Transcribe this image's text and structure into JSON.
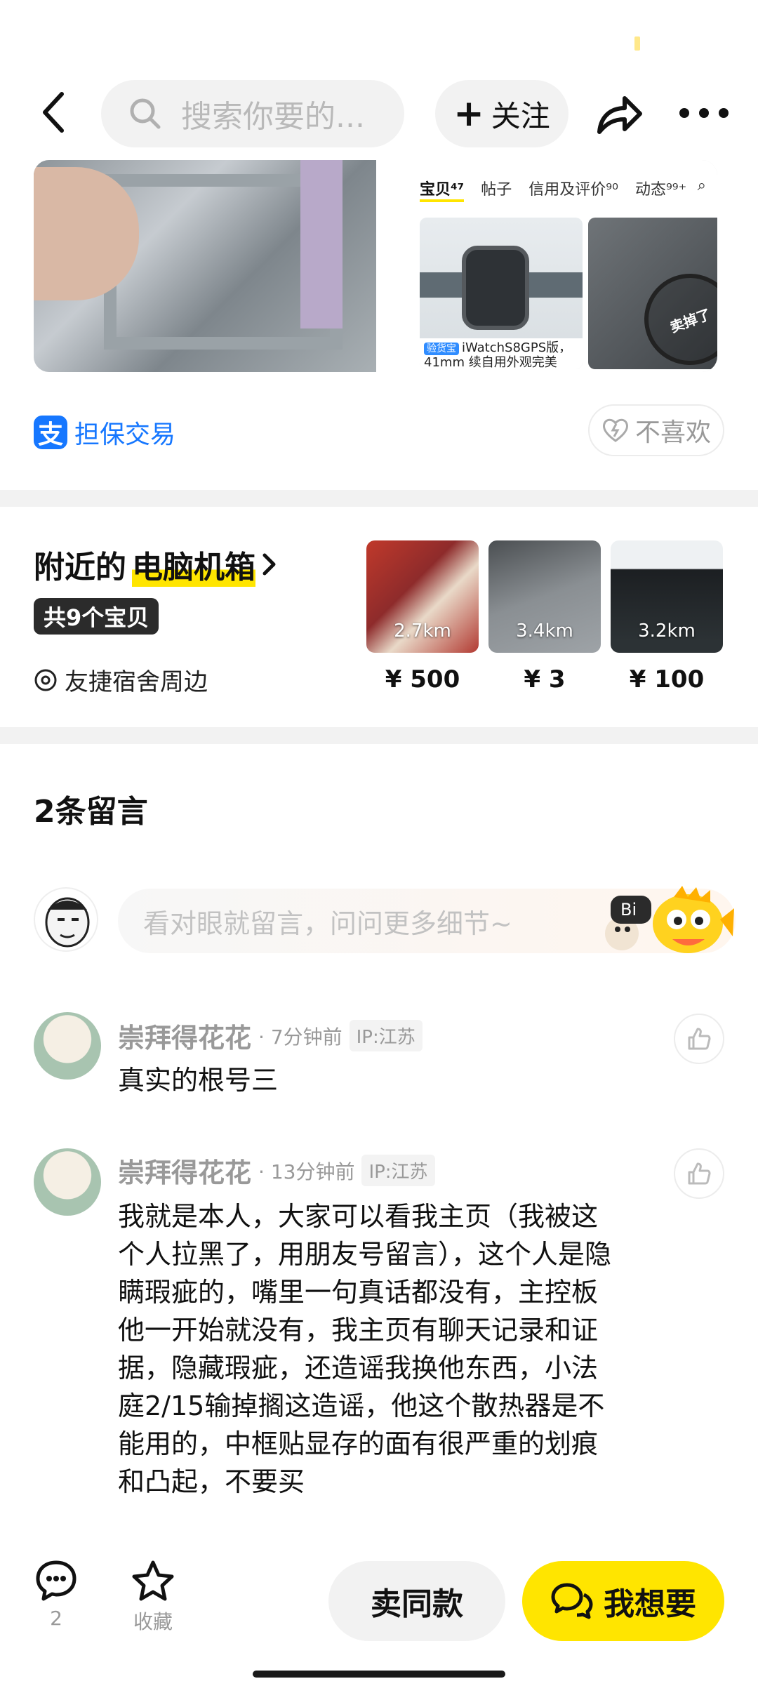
{
  "header": {
    "search_placeholder": "搜索你要的...",
    "follow_label": "关注"
  },
  "gallery": {
    "right_tabs": [
      "宝贝⁴⁷",
      "帖子",
      "信用及评价⁹⁰",
      "动态⁹⁹⁺"
    ],
    "item_tag": "验货宝",
    "item_caption": "iWatchS8GPS版，41mm 续自用外观完美",
    "sold_stamp": "卖掉了"
  },
  "guarantee": {
    "label": "担保交易",
    "dislike_label": "不喜欢"
  },
  "nearby": {
    "title_prefix": "附近的",
    "title_highlight": "电脑机箱",
    "count": "共9个宝贝",
    "location": "友捷宿舍周边",
    "items": [
      {
        "distance": "2.7km",
        "price": "¥ 500"
      },
      {
        "distance": "3.4km",
        "price": "¥ 3"
      },
      {
        "distance": "3.2km",
        "price": "¥ 100"
      }
    ]
  },
  "comments": {
    "title": "2条留言",
    "input_placeholder": "看对眼就留言，问问更多细节~",
    "list": [
      {
        "name": "崇拜得花花",
        "time": "· 7分钟前",
        "ip": "IP:江苏",
        "text": "真实的根号三"
      },
      {
        "name": "崇拜得花花",
        "time": "· 13分钟前",
        "ip": "IP:江苏",
        "text": "我就是本人，大家可以看我主页（我被这个人拉黑了，用朋友号留言），这个人是隐瞒瑕疵的，嘴里一句真话都没有，主控板他一开始就没有，我主页有聊天记录和证据，隐藏瑕疵，还造谣我换他东西，小法庭2/15输掉搁这造谣，他这个散热器是不能用的，中框贴显存的面有很严重的划痕和凸起，不要买"
      }
    ]
  },
  "bottom_bar": {
    "comment_count": "2",
    "favorite_label": "收藏",
    "same_label": "卖同款",
    "want_label": "我想要"
  },
  "colors": {
    "accent_yellow": "#ffe500",
    "alipay_blue": "#1677ff"
  }
}
